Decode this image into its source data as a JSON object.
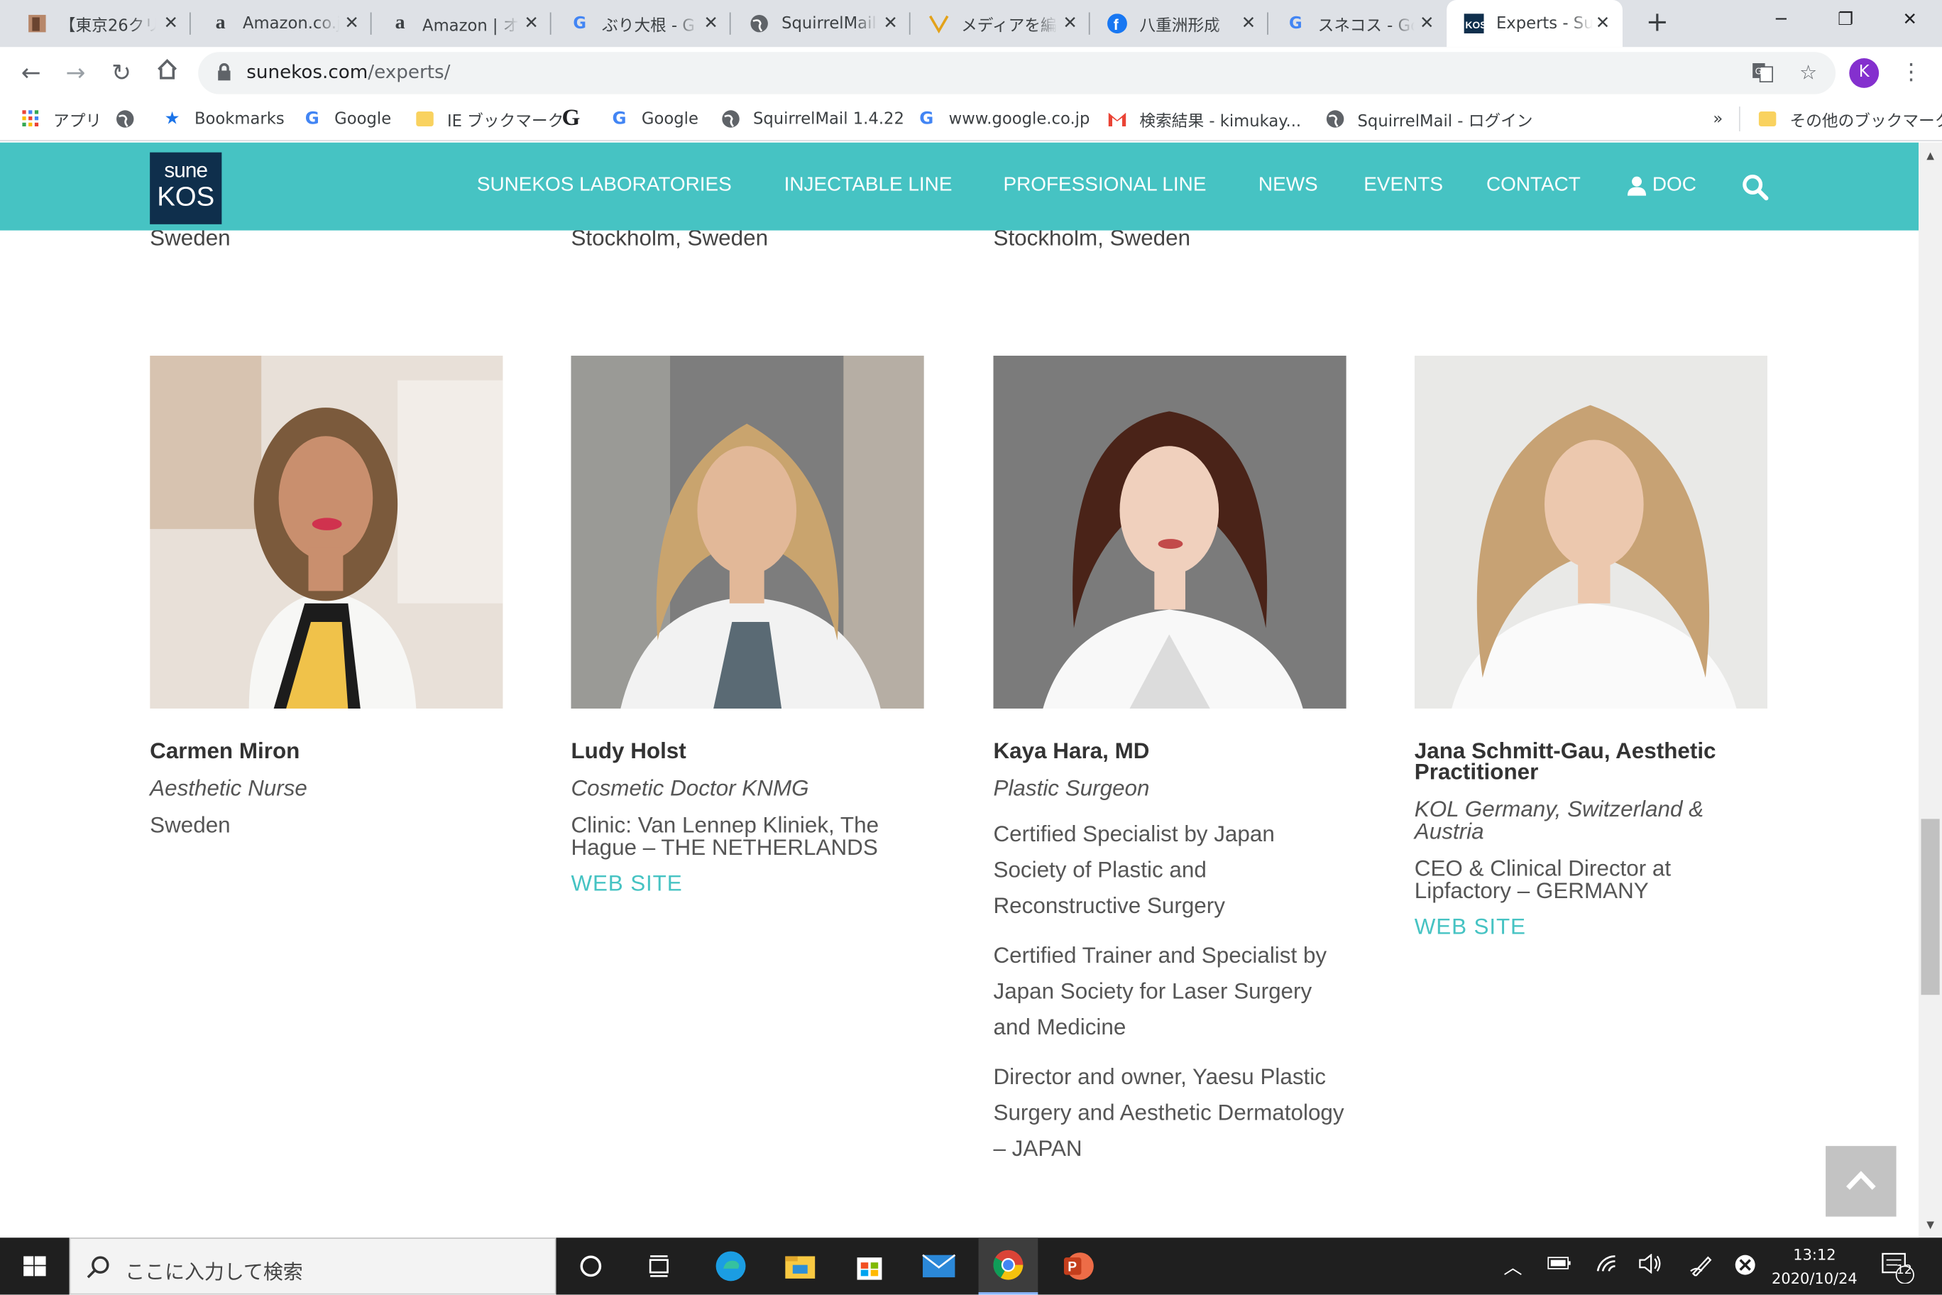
{
  "tabs": [
    {
      "title": "【東京26クリ",
      "icon": "custom"
    },
    {
      "title": "Amazon.co.jp",
      "icon": "amazon"
    },
    {
      "title": "Amazon | オ",
      "icon": "amazon"
    },
    {
      "title": "ぶり大根 - G",
      "icon": "google"
    },
    {
      "title": "SquirrelMail",
      "icon": "globe"
    },
    {
      "title": "メディアを編集",
      "icon": "pen"
    },
    {
      "title": "八重洲形成",
      "icon": "facebook"
    },
    {
      "title": "スネコス - Go",
      "icon": "google"
    },
    {
      "title": "Experts - Su",
      "icon": "sunekos",
      "active": true
    }
  ],
  "address": {
    "domain": "sunekos.com",
    "path": "/experts/"
  },
  "profile_initial": "K",
  "bookmarks": [
    {
      "label": "アプリ",
      "icon": "apps"
    },
    {
      "label": "",
      "icon": "globe"
    },
    {
      "label": "Bookmarks",
      "icon": "star"
    },
    {
      "label": "Google",
      "icon": "google"
    },
    {
      "label": "IE ブックマーク",
      "icon": "folder"
    },
    {
      "label": "",
      "icon": "google-g"
    },
    {
      "label": "Google",
      "icon": "google"
    },
    {
      "label": "SquirrelMail 1.4.22",
      "icon": "globe"
    },
    {
      "label": "www.google.co.jp",
      "icon": "google"
    },
    {
      "label": "検索結果 - kimukay...",
      "icon": "gmail"
    },
    {
      "label": "SquirrelMail - ログイン",
      "icon": "globe"
    }
  ],
  "bookmarks_overflow": "»",
  "other_bookmarks": "その他のブックマーク",
  "site": {
    "logo_top": "sune",
    "logo_bottom": "KOS",
    "nav": [
      "SUNEKOS LABORATORIES",
      "INJECTABLE LINE",
      "PROFESSIONAL LINE",
      "NEWS",
      "EVENTS",
      "CONTACT",
      "DOC"
    ]
  },
  "previous_row": [
    "Sweden",
    "Stockholm, Sweden",
    "Stockholm, Sweden"
  ],
  "experts": [
    {
      "name": "Carmen Miron",
      "role": "Aesthetic Nurse",
      "info": [
        "Sweden"
      ],
      "link": ""
    },
    {
      "name": "Ludy Holst",
      "role": "Cosmetic Doctor KNMG",
      "info": [
        "Clinic: Van Lennep Kliniek, The Hague – THE NETHERLANDS"
      ],
      "link": "WEB SITE"
    },
    {
      "name": "Kaya Hara, MD",
      "role": "Plastic Surgeon",
      "info": [
        "Certified Specialist by Japan Society of Plastic and Reconstructive Surgery",
        "Certified Trainer and Specialist by Japan Society for Laser Surgery and Medicine",
        "Director and owner, Yaesu Plastic Surgery and Aesthetic Dermatology – JAPAN"
      ],
      "link": ""
    },
    {
      "name": "Jana Schmitt-Gau, Aesthetic Practitioner",
      "role": "KOL Germany, Switzerland & Austria",
      "info": [
        "CEO & Clinical Director at Lipfactory – GERMANY"
      ],
      "link": "WEB SITE"
    }
  ],
  "taskbar": {
    "search_placeholder": "ここに入力して検索",
    "time": "13:12",
    "date": "2020/10/24",
    "notifications": "12"
  },
  "colors": {
    "brand_teal": "#46c3c3",
    "logo_navy": "#0f2f4c",
    "link": "#46c3c3"
  }
}
